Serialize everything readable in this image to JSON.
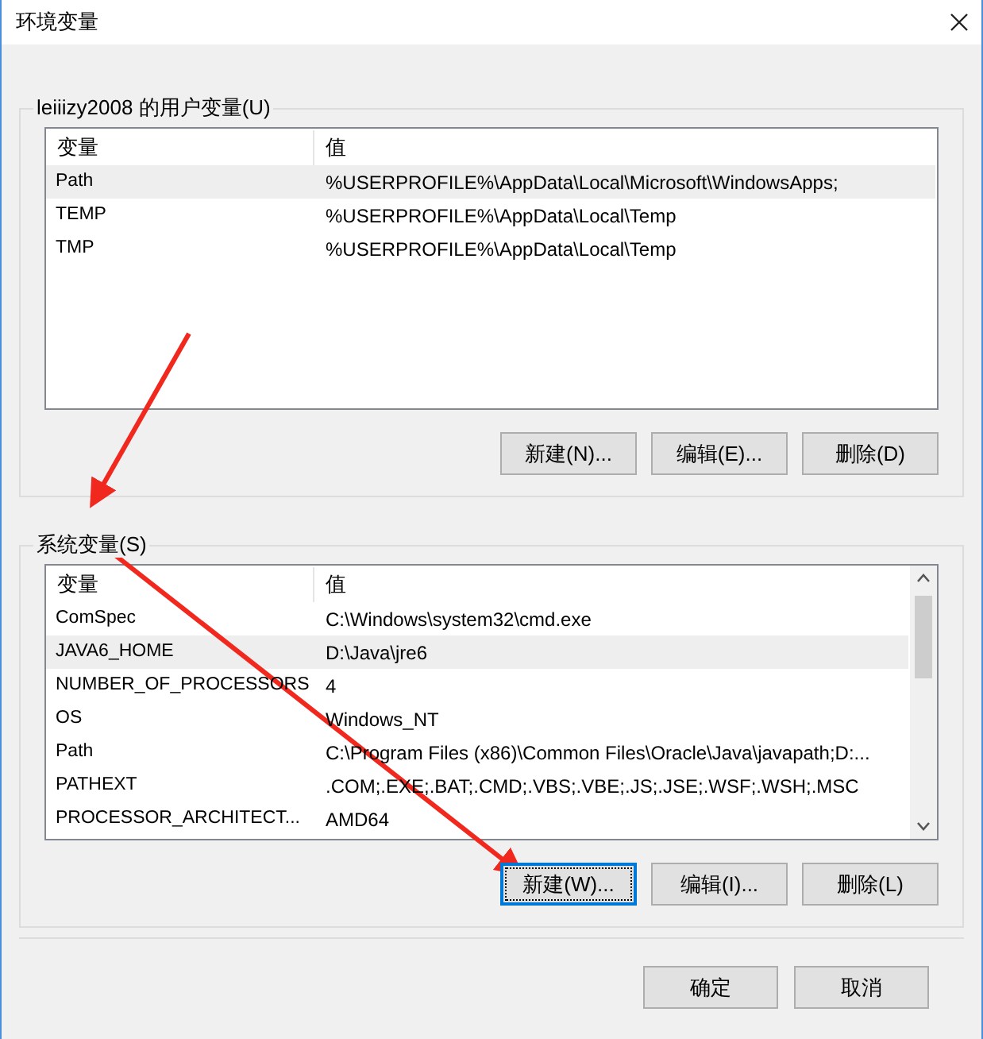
{
  "window": {
    "title": "环境变量"
  },
  "user_variables": {
    "label": "leiiizy2008 的用户变量(U)",
    "columns": [
      "变量",
      "值"
    ],
    "rows": [
      {
        "name": "Path",
        "value": "%USERPROFILE%\\AppData\\Local\\Microsoft\\WindowsApps;",
        "selected": true
      },
      {
        "name": "TEMP",
        "value": "%USERPROFILE%\\AppData\\Local\\Temp",
        "selected": false
      },
      {
        "name": "TMP",
        "value": "%USERPROFILE%\\AppData\\Local\\Temp",
        "selected": false
      }
    ],
    "buttons": [
      {
        "label": "新建(N)...",
        "focused": false
      },
      {
        "label": "编辑(E)...",
        "focused": false
      },
      {
        "label": "删除(D)",
        "focused": false
      }
    ]
  },
  "system_variables": {
    "label": "系统变量(S)",
    "columns": [
      "变量",
      "值"
    ],
    "rows": [
      {
        "name": "ComSpec",
        "value": "C:\\Windows\\system32\\cmd.exe",
        "selected": false
      },
      {
        "name": "JAVA6_HOME",
        "value": "D:\\Java\\jre6",
        "selected": true
      },
      {
        "name": "NUMBER_OF_PROCESSORS",
        "value": "4",
        "selected": false
      },
      {
        "name": "OS",
        "value": "Windows_NT",
        "selected": false
      },
      {
        "name": "Path",
        "value": "C:\\Program Files (x86)\\Common Files\\Oracle\\Java\\javapath;D:...",
        "selected": false
      },
      {
        "name": "PATHEXT",
        "value": ".COM;.EXE;.BAT;.CMD;.VBS;.VBE;.JS;.JSE;.WSF;.WSH;.MSC",
        "selected": false
      },
      {
        "name": "PROCESSOR_ARCHITECT...",
        "value": "AMD64",
        "selected": false
      }
    ],
    "buttons": [
      {
        "label": "新建(W)...",
        "focused": true
      },
      {
        "label": "编辑(I)...",
        "focused": false
      },
      {
        "label": "删除(L)",
        "focused": false
      }
    ]
  },
  "dialog_buttons": [
    {
      "label": "确定"
    },
    {
      "label": "取消"
    }
  ]
}
